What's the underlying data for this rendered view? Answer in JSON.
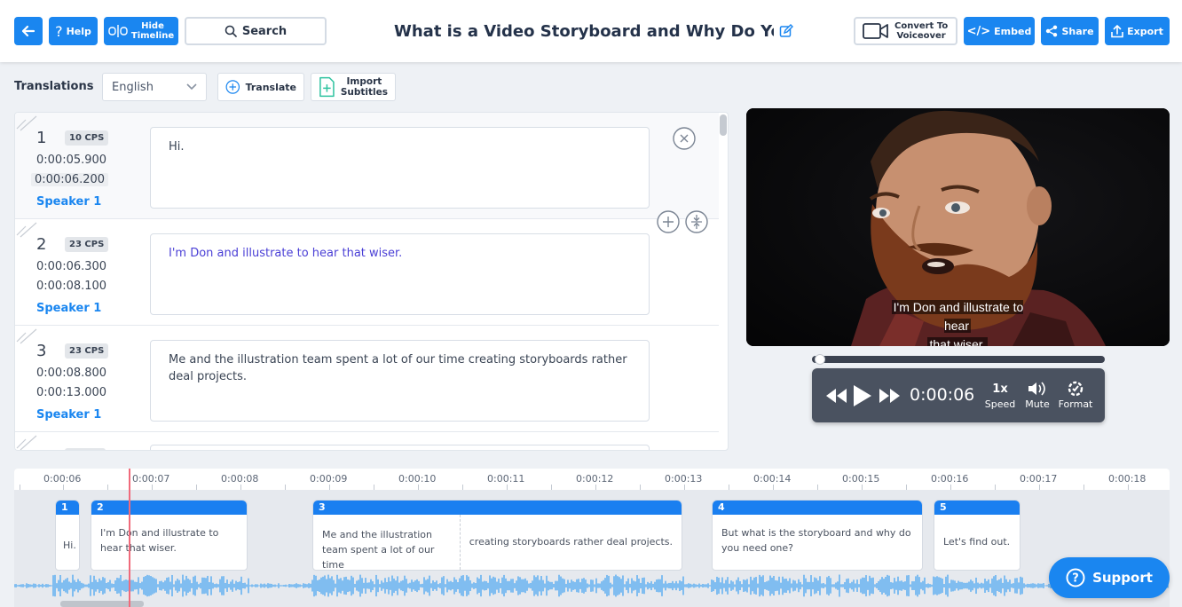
{
  "colors": {
    "accent": "#1a86f0",
    "playhead": "#f06a7b",
    "header_bg": "#ffffff",
    "panel_bg": "#eef1f5"
  },
  "header": {
    "help_label": "Help",
    "hide_timeline_line1": "Hide",
    "hide_timeline_line2": "Timeline",
    "search_label": "Search",
    "title": "What is a Video Storyboard and Why Do You Need One?",
    "convert_line1": "Convert To",
    "convert_line2": "Voiceover",
    "embed_label": "Embed",
    "share_label": "Share",
    "export_label": "Export"
  },
  "translations": {
    "label": "Translations",
    "language": "English",
    "translate_label": "Translate",
    "import_line1": "Import",
    "import_line2": "Subtitles"
  },
  "subtitles": [
    {
      "index": "1",
      "cps": "10 CPS",
      "start": "0:00:05.900",
      "end": "0:00:06.200",
      "speaker": "Speaker 1",
      "text": "Hi."
    },
    {
      "index": "2",
      "cps": "23 CPS",
      "start": "0:00:06.300",
      "end": "0:00:08.100",
      "speaker": "Speaker 1",
      "text": "I'm Don and illustrate to hear that wiser."
    },
    {
      "index": "3",
      "cps": "23 CPS",
      "start": "0:00:08.800",
      "end": "0:00:13.000",
      "speaker": "Speaker 1",
      "text": "Me and the illustration team spent a lot of our time creating storyboards rather deal projects."
    }
  ],
  "video": {
    "caption_line1": "I'm Don and illustrate to hear",
    "caption_line2": "that wiser.",
    "progress": 0.01
  },
  "player": {
    "time": "0:00:06",
    "speed_value": "1x",
    "speed_label": "Speed",
    "mute_label": "Mute",
    "format_label": "Format"
  },
  "timeline": {
    "ticks": [
      "0:00:06",
      "0:00:07",
      "0:00:08",
      "0:00:09",
      "0:00:10",
      "0:00:11",
      "0:00:12",
      "0:00:13",
      "0:00:14",
      "0:00:15",
      "0:00:16",
      "0:00:17",
      "0:00:18"
    ],
    "segments": [
      {
        "num": "1",
        "text": "Hi."
      },
      {
        "num": "2",
        "text": "I'm Don and illustrate to hear that wiser."
      },
      {
        "num": "3",
        "text_a": "Me and the illustration team spent a lot of our time",
        "text_b": "creating storyboards rather deal projects."
      },
      {
        "num": "4",
        "text": "But what is the storyboard and why do you need one?"
      },
      {
        "num": "5",
        "text": "Let's find out."
      }
    ]
  },
  "support_label": "Support"
}
